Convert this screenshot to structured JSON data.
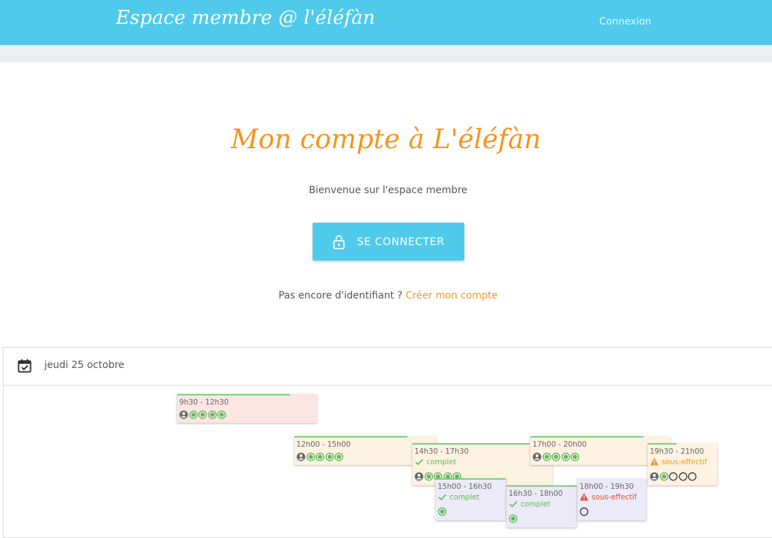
{
  "nav": {
    "brand": "Espace membre @ l'éléfàn",
    "login_link": "Connexion"
  },
  "hero": {
    "title": "Mon compte à L'éléfàn",
    "subtitle": "Bienvenue sur l'espace membre",
    "connect_button": "SE CONNECTER",
    "no_account_text": "Pas encore d'identifiant ? ",
    "create_account_link": "Créer mon compte"
  },
  "calendar": {
    "date": "jeudi 25 octobre",
    "slots": [
      {
        "time": "9h30 - 12h30",
        "status": "",
        "status_type": "",
        "bg": "pink",
        "people": [
          "person",
          "filled",
          "filled",
          "filled",
          "filled"
        ]
      },
      {
        "time": "12h00 - 15h00",
        "status": "",
        "status_type": "",
        "bg": "peach",
        "people": [
          "person",
          "filled",
          "filled",
          "filled",
          "filled"
        ]
      },
      {
        "time": "14h30 - 17h30",
        "status": "complet",
        "status_type": "ok",
        "bg": "peach",
        "people": [
          "person",
          "filled",
          "filled",
          "filled",
          "filled"
        ]
      },
      {
        "time": "17h00 - 20h00",
        "status": "",
        "status_type": "",
        "bg": "peach",
        "people": [
          "person",
          "filled",
          "filled",
          "filled",
          "filled"
        ]
      },
      {
        "time": "19h30 - 21h00",
        "status": "sous-effectif",
        "status_type": "warn",
        "bg": "peach",
        "people": [
          "person",
          "filled",
          "empty",
          "empty",
          "empty"
        ]
      },
      {
        "time": "15h00 - 16h30",
        "status": "complet",
        "status_type": "ok",
        "bg": "lavender",
        "people": [
          "filled"
        ]
      },
      {
        "time": "16h30 - 18h00",
        "status": "complet",
        "status_type": "ok",
        "bg": "lavender",
        "people": [
          "filled"
        ]
      },
      {
        "time": "18h00 - 19h30",
        "status": "sous-effectif",
        "status_type": "alert",
        "bg": "lavender",
        "people": [
          "empty"
        ]
      }
    ]
  },
  "icons": {
    "lock": "lock-icon",
    "calendar": "calendar-check-icon",
    "check": "check-icon",
    "warning": "warning-icon",
    "person": "person-icon",
    "slot_filled": "radio-filled-icon",
    "slot_empty": "radio-empty-icon"
  },
  "colors": {
    "primary": "#4fcaea",
    "accent": "#f7951d",
    "ok": "#5cb85c",
    "alert": "#e74c3c",
    "slot_pink": "#fbe6e3",
    "slot_peach": "#fef2e2",
    "slot_lavender": "#eceaf6"
  }
}
